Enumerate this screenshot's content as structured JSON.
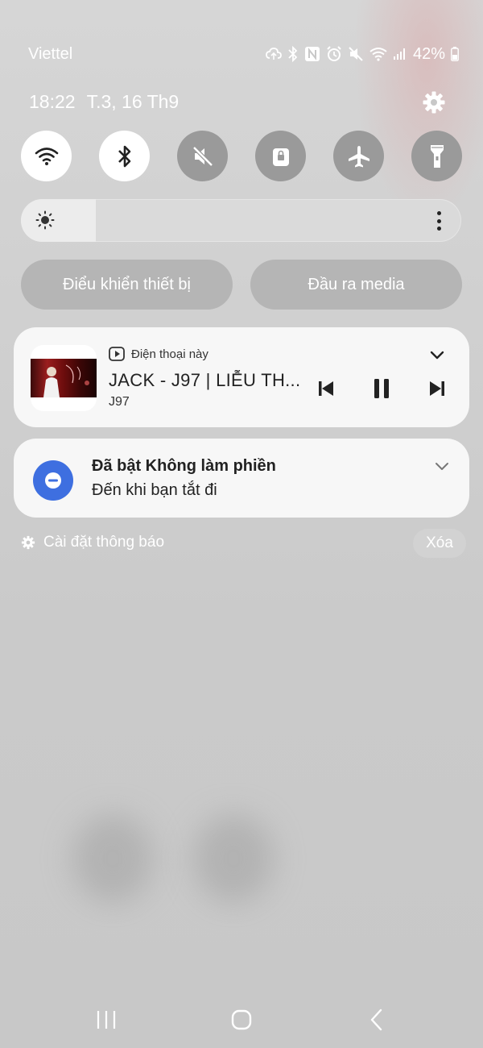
{
  "status_bar": {
    "carrier": "Viettel",
    "battery_percent": "42%",
    "icons": [
      "cloud-sync-icon",
      "bluetooth-icon",
      "nfc-icon",
      "alarm-icon",
      "mute-icon",
      "wifi-icon",
      "signal-icon",
      "battery-icon"
    ]
  },
  "header": {
    "time": "18:22",
    "date": "T.3, 16 Th9"
  },
  "quick_tiles": [
    {
      "name": "wifi",
      "icon": "wifi-icon",
      "state": "on"
    },
    {
      "name": "bluetooth",
      "icon": "bluetooth-icon",
      "state": "on"
    },
    {
      "name": "sound",
      "icon": "mute-icon",
      "state": "off"
    },
    {
      "name": "secure-folder",
      "icon": "lock-icon",
      "state": "off"
    },
    {
      "name": "airplane-mode",
      "icon": "airplane-icon",
      "state": "off"
    },
    {
      "name": "flashlight",
      "icon": "flashlight-icon",
      "state": "off"
    }
  ],
  "brightness": {
    "level": 0.17
  },
  "pills": {
    "device_control": "Điểu khiển thiết bị",
    "media_output": "Đầu ra media"
  },
  "media": {
    "source": "Điện thoại này",
    "title": "JACK - J97 | LIỄU TH...",
    "artist": "J97"
  },
  "dnd": {
    "title": "Đã bật Không làm phiền",
    "subtitle": "Đến khi bạn tắt đi"
  },
  "footer": {
    "notification_settings": "Cài đặt thông báo",
    "clear": "Xóa"
  },
  "colors": {
    "accent": "#3e6fe0",
    "tile_on": "#ffffff",
    "tile_off": "#9a9a9a",
    "card": "#f7f7f7"
  }
}
